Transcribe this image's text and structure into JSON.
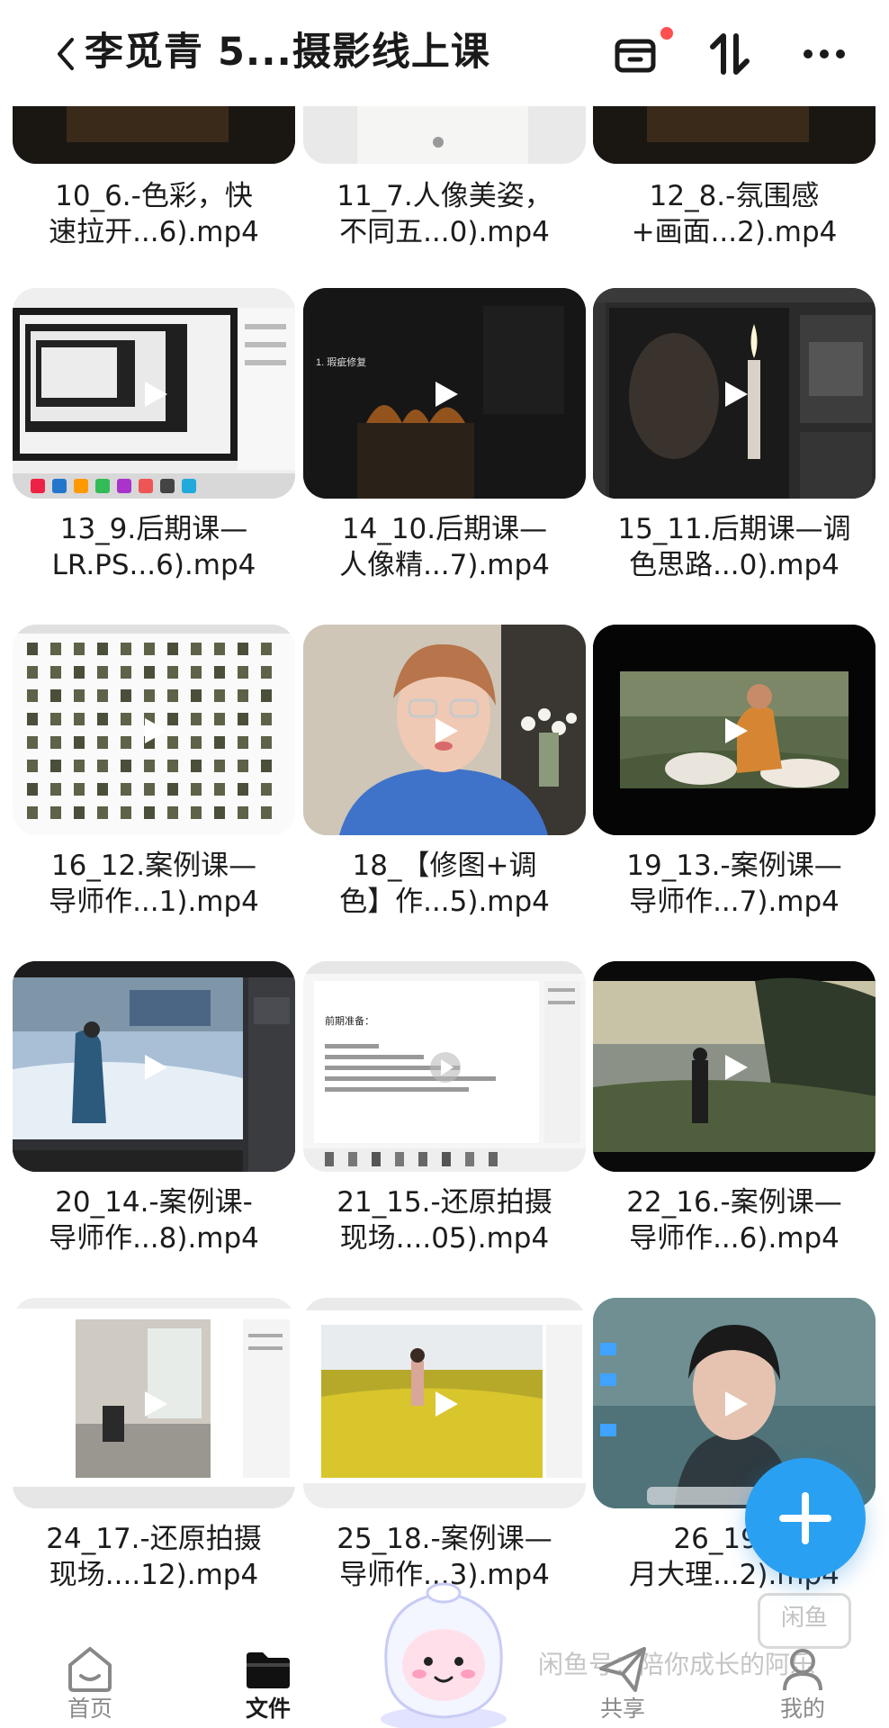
{
  "header": {
    "title": "李觅青 5...摄影线上课"
  },
  "files": [
    {
      "caption": "10_6.-色彩，快\n速拉开...6).mp4"
    },
    {
      "caption": "11_7.人像美姿，\n不同五...0).mp4"
    },
    {
      "caption": "12_8.-氛围感\n+画面...2).mp4"
    },
    {
      "caption": "13_9.后期课—\nLR.PS...6).mp4"
    },
    {
      "caption": "14_10.后期课—\n人像精...7).mp4"
    },
    {
      "caption": "15_11.后期课—调\n色思路...0).mp4"
    },
    {
      "caption": "16_12.案例课—\n导师作...1).mp4"
    },
    {
      "caption": "18_【修图+调\n色】作...5).mp4"
    },
    {
      "caption": "19_13.-案例课—\n导师作...7).mp4"
    },
    {
      "caption": "20_14.-案例课-\n导师作...8).mp4"
    },
    {
      "caption": "21_15.-还原拍摄\n现场....05).mp4"
    },
    {
      "caption": "22_16.-案例课—\n导师作...6).mp4"
    },
    {
      "caption": "24_17.-还原拍摄\n现场....12).mp4"
    },
    {
      "caption": "25_18.-案例课—\n导师作...3).mp4"
    },
    {
      "caption": "26_19.-2\n月大理...2).mp4"
    }
  ],
  "thumbnail_text": {
    "video14_slide": "1. 瑕疵修复",
    "video21_slide": "前期准备："
  },
  "tabs": [
    {
      "label": "首页",
      "icon": "home-face-icon"
    },
    {
      "label": "文件",
      "icon": "folder-icon"
    },
    {
      "label": "共享",
      "icon": "paper-plane-icon"
    },
    {
      "label": "我的",
      "icon": "profile-icon"
    }
  ],
  "watermark": {
    "text": "闲鱼号：陪你成长的阿乐",
    "logo": "闲鱼"
  },
  "colors": {
    "accent": "#2aa0f2",
    "badge": "#ff4f4f"
  }
}
